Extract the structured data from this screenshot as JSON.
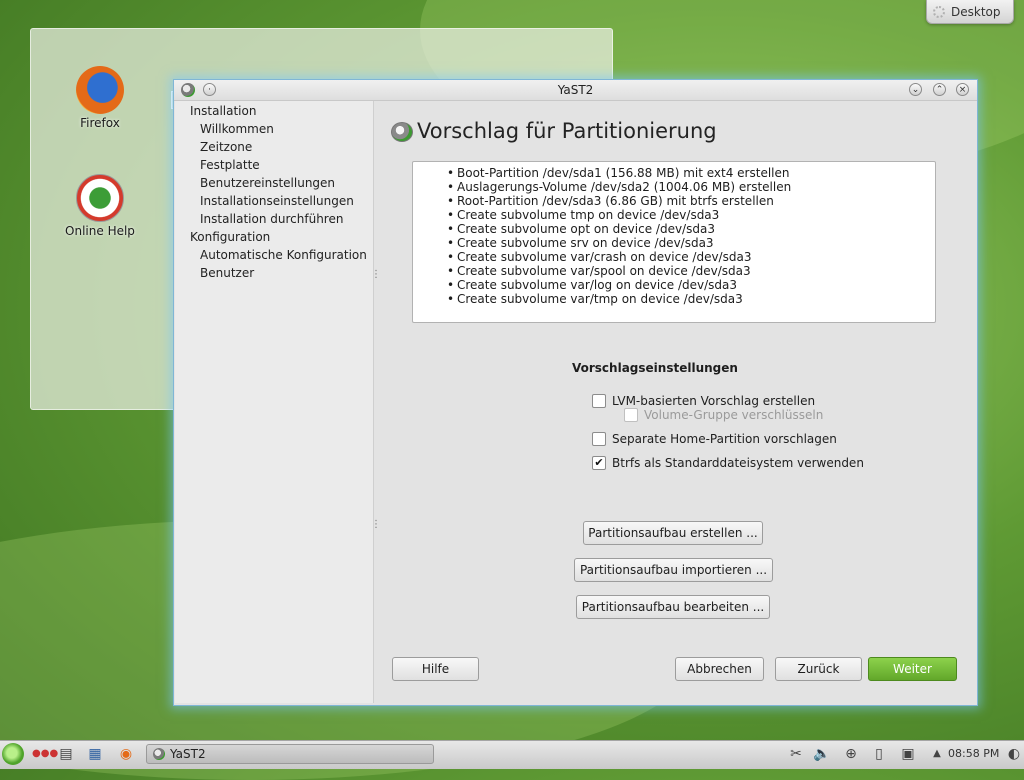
{
  "desktop": {
    "toolbox_label": "Desktop",
    "icons": [
      {
        "label": "Firefox"
      },
      {
        "label": "Online Help"
      }
    ]
  },
  "window": {
    "title": "YaST2",
    "controls": [
      "minimize",
      "maximize",
      "close"
    ]
  },
  "sidebar": {
    "steps": [
      {
        "label": "Installation",
        "level": 0
      },
      {
        "label": "Willkommen",
        "level": 1
      },
      {
        "label": "Zeitzone",
        "level": 1
      },
      {
        "label": "Festplatte",
        "level": 1
      },
      {
        "label": "Benutzereinstellungen",
        "level": 1
      },
      {
        "label": "Installationseinstellungen",
        "level": 1
      },
      {
        "label": "Installation durchführen",
        "level": 1
      },
      {
        "label": "Konfiguration",
        "level": 0
      },
      {
        "label": "Automatische Konfiguration",
        "level": 1
      },
      {
        "label": "Benutzer",
        "level": 1
      }
    ]
  },
  "main": {
    "heading": "Vorschlag für Partitionierung",
    "proposal_items": [
      "Boot-Partition /dev/sda1 (156.88 MB) mit ext4 erstellen",
      "Auslagerungs-Volume /dev/sda2 (1004.06 MB) erstellen",
      "Root-Partition /dev/sda3 (6.86 GB) mit btrfs erstellen",
      "Create subvolume tmp on device /dev/sda3",
      "Create subvolume opt on device /dev/sda3",
      "Create subvolume srv on device /dev/sda3",
      "Create subvolume var/crash on device /dev/sda3",
      "Create subvolume var/spool on device /dev/sda3",
      "Create subvolume var/log on device /dev/sda3",
      "Create subvolume var/tmp on device /dev/sda3"
    ],
    "settings_title": "Vorschlagseinstellungen",
    "options": {
      "lvm": {
        "label": "LVM-basierten Vorschlag erstellen",
        "checked": false
      },
      "encrypt": {
        "label": "Volume-Gruppe verschlüsseln",
        "checked": false,
        "disabled": true
      },
      "home": {
        "label": "Separate Home-Partition vorschlagen",
        "checked": false
      },
      "btrfs": {
        "label": "Btrfs als Standarddateisystem verwenden",
        "checked": true
      }
    },
    "buttons": {
      "create": "Partitionsaufbau erstellen ...",
      "import": "Partitionsaufbau importieren ...",
      "edit": "Partitionsaufbau bearbeiten ..."
    }
  },
  "footer": {
    "help": "Hilfe",
    "cancel": "Abbrechen",
    "back": "Zurück",
    "next": "Weiter"
  },
  "taskbar": {
    "task_label": "YaST2",
    "clock": "08:58 PM"
  },
  "colors": {
    "accent_green": "#6ab733",
    "window_glow": "#7fc8ff"
  }
}
